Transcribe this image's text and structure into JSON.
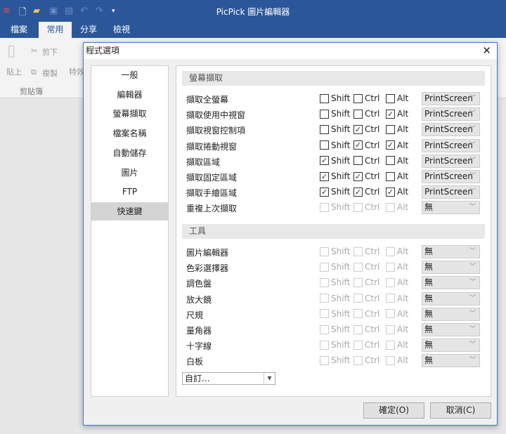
{
  "app": {
    "title": "PicPick 圖片編輯器"
  },
  "tabs": [
    {
      "label": "檔案"
    },
    {
      "label": "常用",
      "active": true
    },
    {
      "label": "分享"
    },
    {
      "label": "檢視"
    }
  ],
  "ribbon": {
    "paste": "貼上",
    "cut": "剪下",
    "copy": "複製",
    "effects": "特效",
    "group": "剪貼簿"
  },
  "dialog": {
    "title": "程式選項",
    "ok": "確定(O)",
    "cancel": "取消(C)",
    "custom": "自訂..."
  },
  "nav": [
    {
      "label": "一般"
    },
    {
      "label": "編輯器"
    },
    {
      "label": "螢幕擷取"
    },
    {
      "label": "檔案名稱"
    },
    {
      "label": "自動儲存"
    },
    {
      "label": "圖片"
    },
    {
      "label": "FTP"
    },
    {
      "label": "快速鍵",
      "selected": true
    }
  ],
  "modifiers": [
    "Shift",
    "Ctrl",
    "Alt"
  ],
  "sections": [
    {
      "title": "螢幕擷取",
      "rows": [
        {
          "label": "擷取全螢幕",
          "shift": false,
          "ctrl": false,
          "alt": false,
          "key": "PrintScreen",
          "enabled": true
        },
        {
          "label": "擷取使用中視窗",
          "shift": false,
          "ctrl": false,
          "alt": true,
          "key": "PrintScreen",
          "enabled": true
        },
        {
          "label": "擷取視窗控制項",
          "shift": false,
          "ctrl": true,
          "alt": false,
          "key": "PrintScreen",
          "enabled": true
        },
        {
          "label": "擷取捲動視窗",
          "shift": false,
          "ctrl": true,
          "alt": true,
          "key": "PrintScreen",
          "enabled": true
        },
        {
          "label": "擷取區域",
          "shift": true,
          "ctrl": false,
          "alt": false,
          "key": "PrintScreen",
          "enabled": true
        },
        {
          "label": "擷取固定區域",
          "shift": true,
          "ctrl": true,
          "alt": false,
          "key": "PrintScreen",
          "enabled": true
        },
        {
          "label": "擷取手繪區域",
          "shift": true,
          "ctrl": true,
          "alt": true,
          "key": "PrintScreen",
          "enabled": true
        },
        {
          "label": "重複上次擷取",
          "shift": false,
          "ctrl": false,
          "alt": false,
          "key": "無",
          "enabled": false
        }
      ]
    },
    {
      "title": "工具",
      "rows": [
        {
          "label": "圖片編輯器",
          "shift": false,
          "ctrl": false,
          "alt": false,
          "key": "無",
          "enabled": false
        },
        {
          "label": "色彩選擇器",
          "shift": false,
          "ctrl": false,
          "alt": false,
          "key": "無",
          "enabled": false
        },
        {
          "label": "調色盤",
          "shift": false,
          "ctrl": false,
          "alt": false,
          "key": "無",
          "enabled": false
        },
        {
          "label": "放大鏡",
          "shift": false,
          "ctrl": false,
          "alt": false,
          "key": "無",
          "enabled": false
        },
        {
          "label": "尺規",
          "shift": false,
          "ctrl": false,
          "alt": false,
          "key": "無",
          "enabled": false
        },
        {
          "label": "量角器",
          "shift": false,
          "ctrl": false,
          "alt": false,
          "key": "無",
          "enabled": false
        },
        {
          "label": "十字線",
          "shift": false,
          "ctrl": false,
          "alt": false,
          "key": "無",
          "enabled": false
        },
        {
          "label": "白板",
          "shift": false,
          "ctrl": false,
          "alt": false,
          "key": "無",
          "enabled": false
        }
      ]
    }
  ],
  "colors": {
    "brand": "#2b579a"
  }
}
